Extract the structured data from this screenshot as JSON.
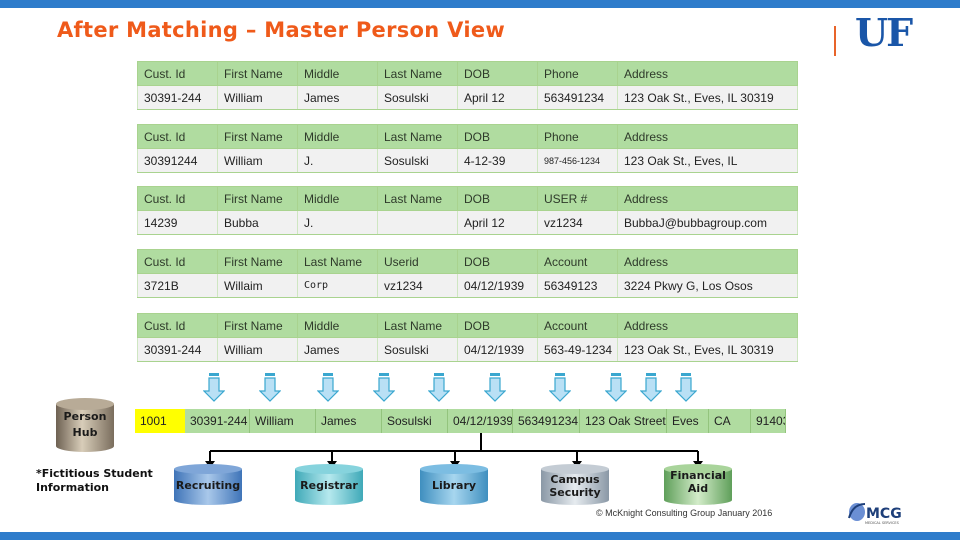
{
  "title": "After Matching – Master Person View",
  "logo": {
    "text": "UF",
    "accent_bar_color": "#e8642a",
    "color": "#1a56a8"
  },
  "colors": {
    "title": "#ef5a1a",
    "header_bar": "#2e7ccb",
    "table_header": "#b0dca0",
    "table_value": "#f1f1f1",
    "hub_key": "#ffff00"
  },
  "records": [
    {
      "headers": [
        "Cust. Id",
        "First Name",
        "Middle",
        "Last Name",
        "DOB",
        "Phone",
        "Address"
      ],
      "values": [
        "30391-244",
        "William",
        "James",
        "Sosulski",
        "April 12",
        "563491234",
        "123 Oak St., Eves, IL 30319"
      ]
    },
    {
      "headers": [
        "Cust. Id",
        "First Name",
        "Middle",
        "Last Name",
        "DOB",
        "Phone",
        "Address"
      ],
      "values": [
        "30391244",
        "William",
        "J.",
        "Sosulski",
        "4-12-39",
        "987-456-1234",
        "123 Oak St., Eves, IL"
      ]
    },
    {
      "headers": [
        "Cust. Id",
        "First Name",
        "Middle",
        "Last Name",
        "DOB",
        "USER #",
        "Address"
      ],
      "values": [
        "14239",
        "Bubba",
        "J.",
        "",
        "April 12",
        "vz1234",
        "BubbaJ@bubbagroup.com"
      ]
    },
    {
      "headers": [
        "Cust. Id",
        "First Name",
        "Last Name",
        "Userid",
        "DOB",
        "Account",
        "Address"
      ],
      "values": [
        "3721B",
        "Willaim",
        "Corp",
        "vz1234",
        "04/12/1939",
        "56349123",
        "3224 Pkwy G, Los Osos"
      ]
    },
    {
      "headers": [
        "Cust. Id",
        "First Name",
        "Middle",
        "Last Name",
        "DOB",
        "Account",
        "Address"
      ],
      "values": [
        "30391-244",
        "William",
        "James",
        "Sosulski",
        "04/12/1939",
        "563-49-1234",
        "123 Oak St., Eves, IL 30319"
      ]
    }
  ],
  "hub": {
    "label_line1": "Person",
    "label_line2": "Hub",
    "row": [
      "1001",
      "30391-244",
      "William",
      "James",
      "Sosulski",
      "04/12/1939",
      "563491234",
      "123 Oak Street",
      "Eves",
      "CA",
      "91403"
    ]
  },
  "arrows": {
    "icon": "down-arrow-icon",
    "count": 10
  },
  "systems": [
    {
      "name": "Recruiting",
      "line1": "Recruiting",
      "line2": ""
    },
    {
      "name": "Registrar",
      "line1": "Registrar",
      "line2": ""
    },
    {
      "name": "Library",
      "line1": "Library",
      "line2": ""
    },
    {
      "name": "Campus Security",
      "line1": "Campus",
      "line2": "Security"
    },
    {
      "name": "Financial Aid",
      "line1": "Financial",
      "line2": "Aid"
    }
  ],
  "note_line1": "*Fictitious Student",
  "note_line2": "Information",
  "copyright": "© McKnight Consulting Group January 2016",
  "mcg_logo": {
    "text": "MCG",
    "tagline": "MEDICAL SERVICES"
  }
}
